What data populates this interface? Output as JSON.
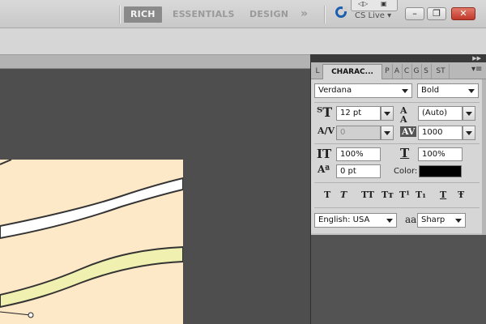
{
  "workspace": {
    "tabs": [
      "RICH",
      "ESSENTIALS",
      "DESIGN"
    ],
    "more_glyph": "»",
    "cs_live_label": "CS Live ▾"
  },
  "window_controls": {
    "minimize": "–",
    "restore": "❐",
    "close": "✕"
  },
  "panel_tabs": {
    "tabs": [
      "L",
      "CHARAC...",
      "P",
      "A",
      "C",
      "G",
      "S",
      "ST"
    ],
    "active": "CHARAC...",
    "menu_glyph": "▾≡"
  },
  "character": {
    "font_family": "Verdana",
    "font_style": "Bold",
    "font_size": "12 pt",
    "leading": "(Auto)",
    "kerning": "0",
    "tracking": "1000",
    "vertical_scale": "100%",
    "horizontal_scale": "100%",
    "baseline_shift": "0 pt",
    "color_label": "Color:",
    "color_value": "#000000",
    "language": "English: USA",
    "antialias_icon_label": "aa",
    "antialias": "Sharp",
    "type_buttons": [
      "T",
      "T",
      "TT",
      "Tт",
      "T¹",
      "T₁",
      "T",
      "Ŧ"
    ]
  },
  "colors": {
    "canvas_fill": "#FDE8C8",
    "wave_light": "#F0F0B0"
  }
}
